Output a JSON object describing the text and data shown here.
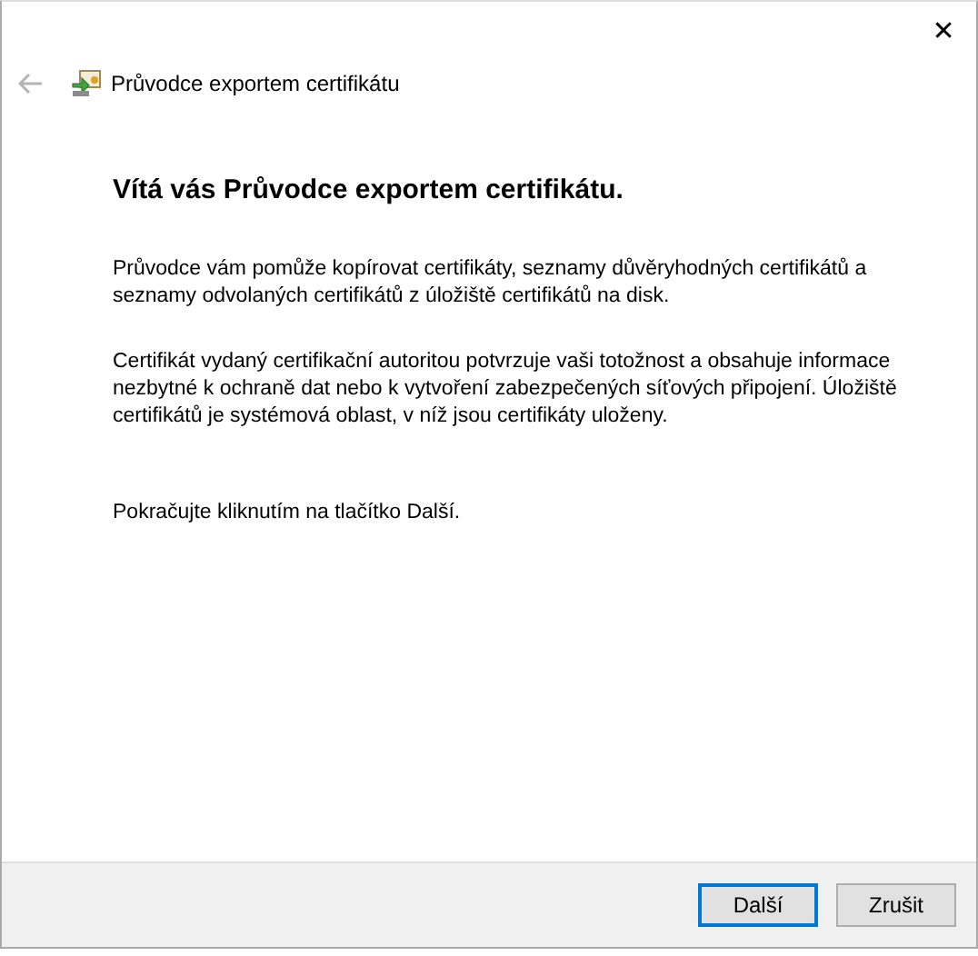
{
  "window": {
    "title": "Průvodce exportem certifikátu",
    "close": "✕"
  },
  "heading": "Vítá vás Průvodce exportem certifikátu.",
  "paragraphs": [
    "Průvodce vám pomůže kopírovat certifikáty, seznamy důvěryhodných certifikátů a seznamy odvolaných certifikátů z úložiště certifikátů na disk.",
    "Certifikát vydaný certifikační autoritou potvrzuje vaši totožnost a obsahuje informace nezbytné k ochraně dat nebo k vytvoření zabezpečených síťových připojení. Úložiště certifikátů je systémová oblast, v níž jsou certifikáty uloženy.",
    "Pokračujte kliknutím na tlačítko Další."
  ],
  "buttons": [
    {
      "label": "Další",
      "selected": true
    },
    {
      "label": "Zrušit",
      "selected": false
    }
  ]
}
